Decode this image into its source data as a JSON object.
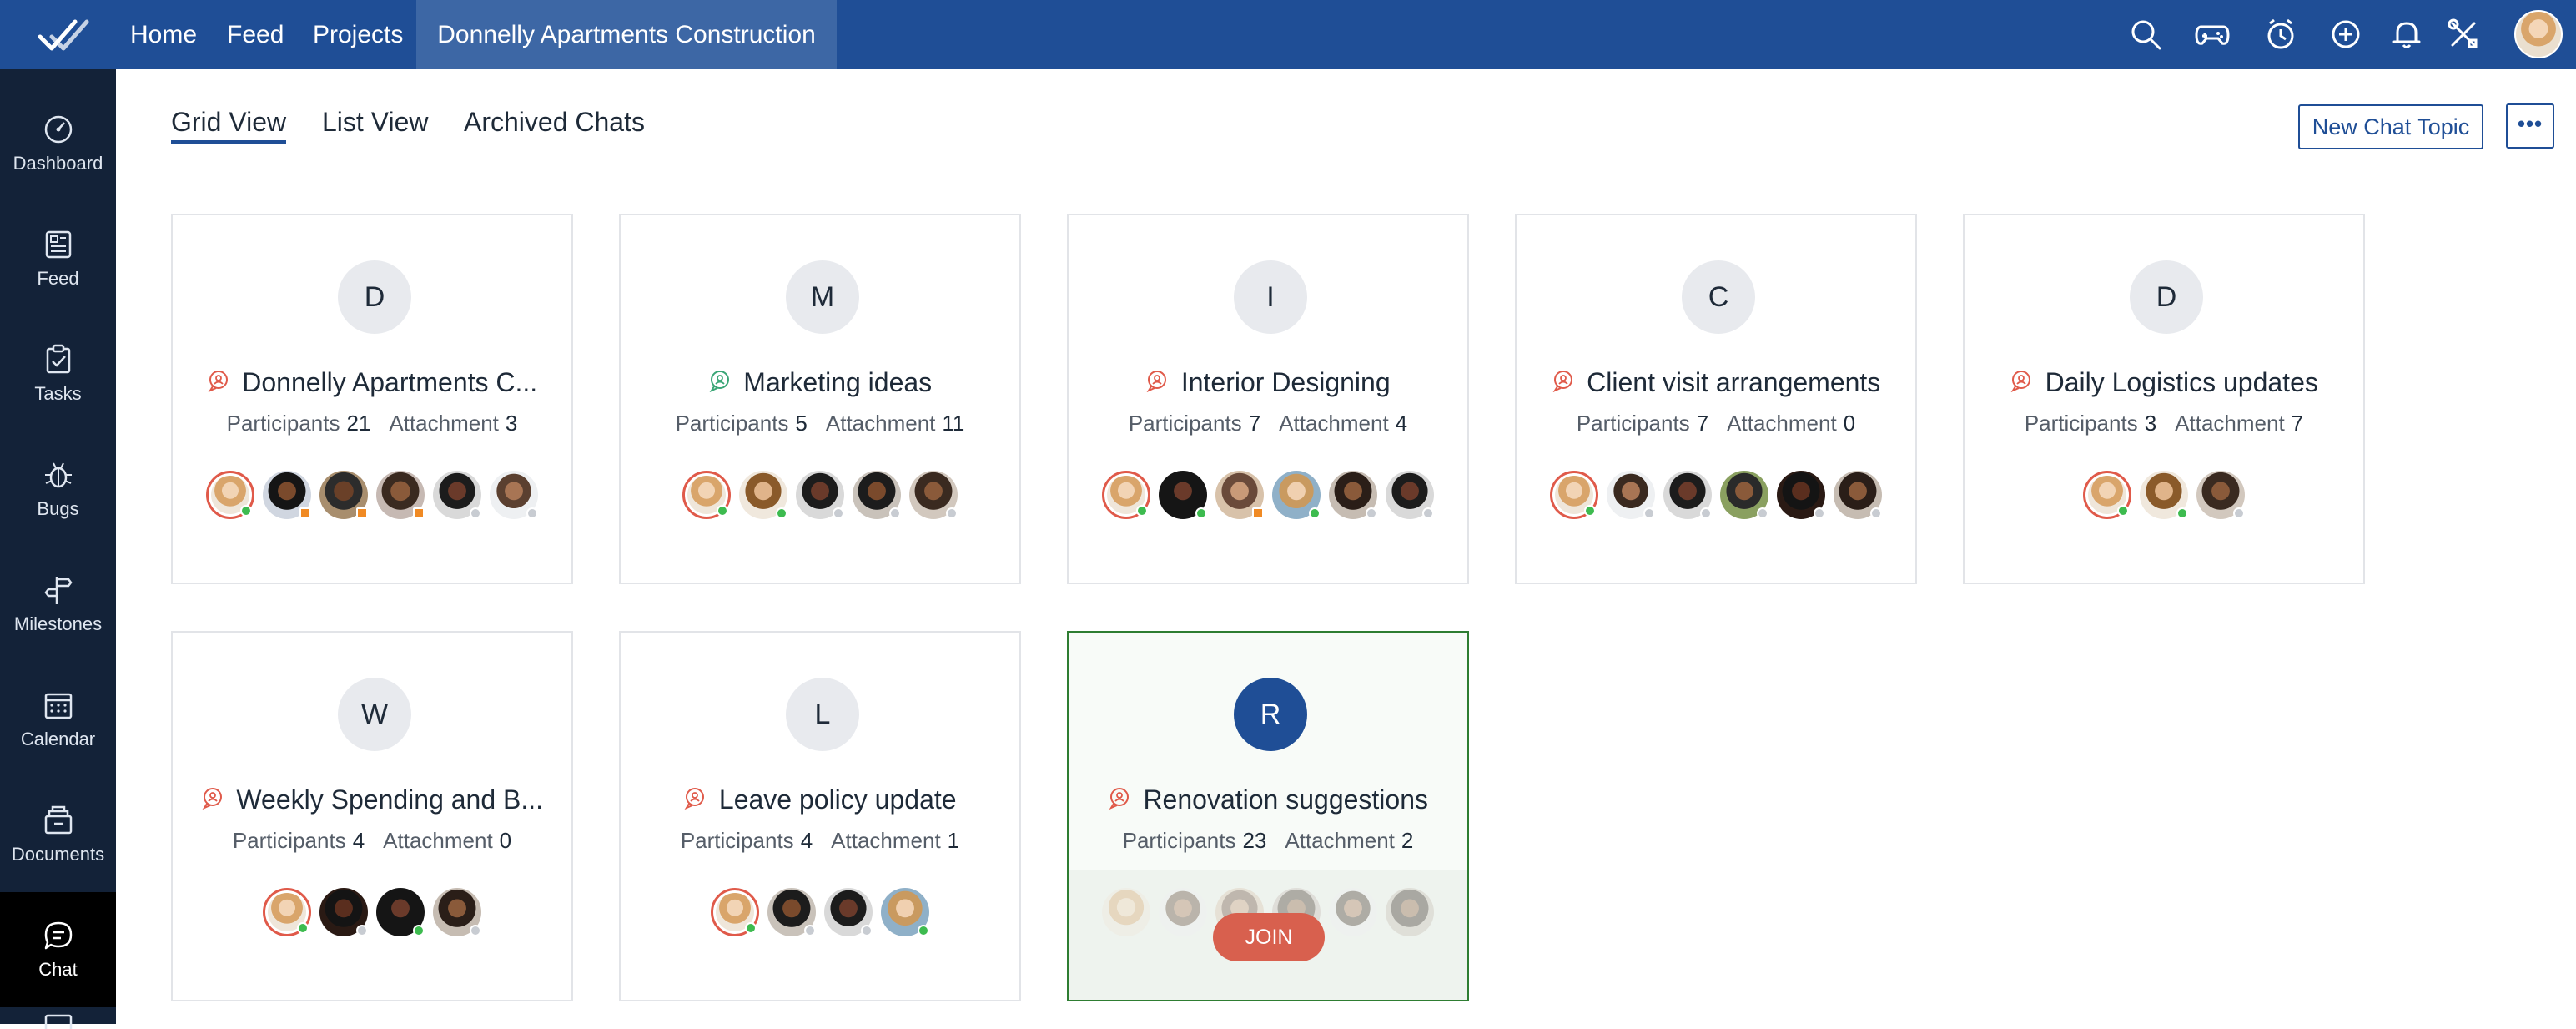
{
  "topbar": {
    "nav": [
      "Home",
      "Feed",
      "Projects"
    ],
    "active_project": "Donnelly Apartments Construction",
    "icons": [
      "search-icon",
      "gamepad-icon",
      "timer-icon",
      "add-icon",
      "bell-icon",
      "tools-icon"
    ],
    "accent_color": "#1f4e96"
  },
  "sidebar": {
    "items": [
      {
        "label": "Dashboard",
        "icon": "dashboard-icon"
      },
      {
        "label": "Feed",
        "icon": "feed-icon"
      },
      {
        "label": "Tasks",
        "icon": "tasks-icon"
      },
      {
        "label": "Bugs",
        "icon": "bug-icon"
      },
      {
        "label": "Milestones",
        "icon": "milestone-icon"
      },
      {
        "label": "Calendar",
        "icon": "calendar-icon"
      },
      {
        "label": "Documents",
        "icon": "documents-icon"
      },
      {
        "label": "Chat",
        "icon": "chat-icon"
      }
    ],
    "active": "Chat"
  },
  "tabs": [
    "Grid View",
    "List View",
    "Archived Chats"
  ],
  "active_tab": "Grid View",
  "actions": {
    "new_chat": "New Chat Topic",
    "more": "•••"
  },
  "labels": {
    "participants": "Participants",
    "attachment": "Attachment",
    "join": "JOIN"
  },
  "cards": [
    {
      "initial": "D",
      "title": "Donnelly Apartments C...",
      "participants": "21",
      "attachments": "3"
    },
    {
      "initial": "M",
      "title": "Marketing ideas",
      "participants": "5",
      "attachments": "11"
    },
    {
      "initial": "I",
      "title": "Interior Designing",
      "participants": "7",
      "attachments": "4"
    },
    {
      "initial": "C",
      "title": "Client visit arrangements",
      "participants": "7",
      "attachments": "0"
    },
    {
      "initial": "D",
      "title": "Daily Logistics updates",
      "participants": "3",
      "attachments": "7"
    },
    {
      "initial": "W",
      "title": "Weekly Spending and B...",
      "participants": "4",
      "attachments": "0"
    },
    {
      "initial": "L",
      "title": "Leave policy update",
      "participants": "4",
      "attachments": "1"
    },
    {
      "initial": "R",
      "title": "Renovation suggestions",
      "participants": "23",
      "attachments": "2"
    }
  ]
}
